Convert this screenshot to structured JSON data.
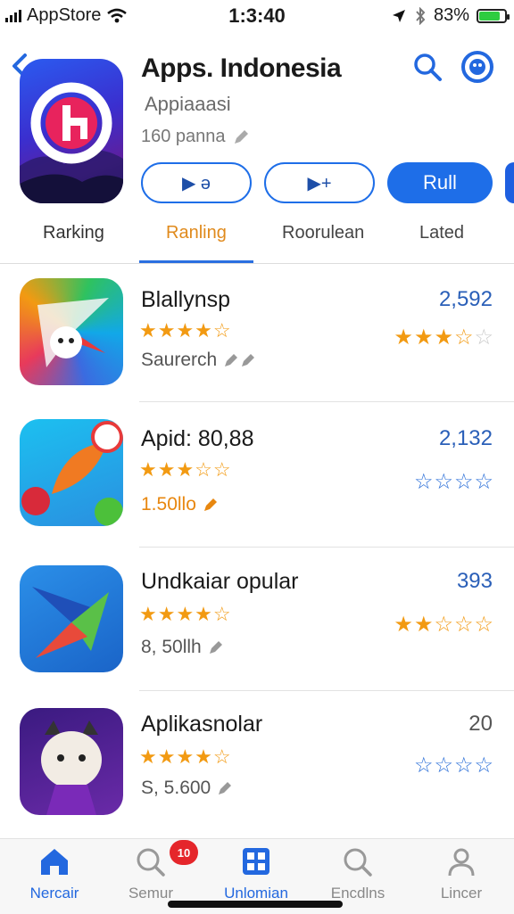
{
  "status_bar": {
    "carrier": "AppStore",
    "time": "1:3:40",
    "battery": "83%",
    "battery_level": 0.83
  },
  "header": {
    "title": "Apps. Indonesia",
    "subtitle": "Appiaaasi",
    "count": "160 panna",
    "buttons": [
      {
        "label": "▶ ə"
      },
      {
        "label": "▶+"
      },
      {
        "label": "Rull"
      }
    ]
  },
  "tabs": [
    {
      "label": "Rarking"
    },
    {
      "label": "Ranling"
    },
    {
      "label": "Roorulean"
    },
    {
      "label": "Lated"
    }
  ],
  "apps": [
    {
      "name": "Blallynsp",
      "rating_stars": "★★★★☆",
      "sub": "Saurerch",
      "count": "2,592",
      "right_stars": "★★★☆",
      "right_stars_empty": "☆"
    },
    {
      "name": "Apid: 80,88",
      "rating_stars": "★★★☆☆",
      "sub": "1.50llo",
      "count": "2,132",
      "right_stars": "☆☆☆☆"
    },
    {
      "name": "Undkaiar opular",
      "rating_stars": "★★★★☆",
      "sub": "8, 50llh",
      "count": "393",
      "right_stars": "★★☆☆☆"
    },
    {
      "name": "Aplikasnolar",
      "rating_stars": "★★★★☆",
      "sub": "S, 5.600",
      "count": "20",
      "right_stars": "☆☆☆☆"
    }
  ],
  "tabbar": {
    "badge": "10",
    "items": [
      {
        "label": "Nercair"
      },
      {
        "label": "Semur"
      },
      {
        "label": "Unlomian"
      },
      {
        "label": "Encdlns"
      },
      {
        "label": "Lincer"
      }
    ]
  },
  "colors": {
    "accent": "#1e6ee8",
    "star": "#f29a12",
    "badge": "#e5262b"
  }
}
